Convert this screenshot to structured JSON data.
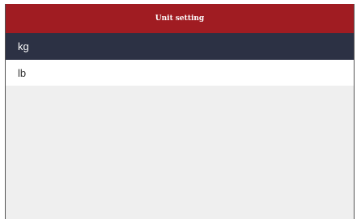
{
  "header": {
    "title": "Unit setting"
  },
  "units": [
    {
      "label": "kg",
      "selected": true
    },
    {
      "label": "lb",
      "selected": false
    }
  ],
  "colors": {
    "header_bg": "#a01c22",
    "selected_bg": "#2c3144",
    "selected_text": "#ffffff",
    "unselected_bg": "#ffffff",
    "unselected_text": "#333333",
    "content_bg": "#efefef"
  }
}
